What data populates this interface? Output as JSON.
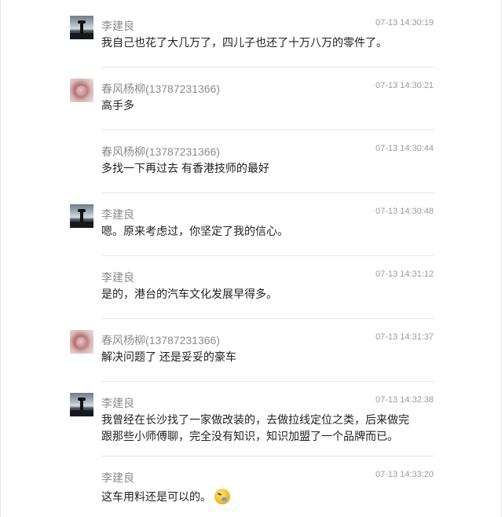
{
  "messages": [
    {
      "author": "李建良",
      "time": "07-13 14:30:19",
      "avatar": "lake-avatar",
      "text": "我自己也花了大几万了，四儿子也还了十万八万的零件了。"
    },
    {
      "author": "春风杨柳(13787231366)",
      "time": "07-13 14:30:21",
      "avatar": "flower-avatar",
      "text": "高手多"
    },
    {
      "author": "春风杨柳(13787231366)",
      "time": "07-13 14:30:44",
      "avatar": "",
      "text": "多找一下再过去 有香港技师的最好"
    },
    {
      "author": "李建良",
      "time": "07-13 14:30:48",
      "avatar": "lake-avatar",
      "text": "嗯。原来考虑过，你坚定了我的信心。"
    },
    {
      "author": "李建良",
      "time": "07-13 14:31:12",
      "avatar": "",
      "text": "是的，港台的汽车文化发展早得多。"
    },
    {
      "author": "春风杨柳(13787231366)",
      "time": "07-13 14:31:37",
      "avatar": "flower-avatar",
      "text": "解决问题了 还是妥妥的豪车"
    },
    {
      "author": "李建良",
      "time": "07-13 14:32:38",
      "avatar": "lake-avatar",
      "text_lines": [
        "我曾经在长沙找了一家做改装的，去做拉线定位之类，后来做完",
        "跟那些小师傅聊，完全没有知识，知识加盟了一个品牌而已。"
      ]
    },
    {
      "author": "李建良",
      "time": "07-13 14:33:20",
      "avatar": "",
      "text": "这车用料还是可以的。",
      "emoji": "crying-laughing-emoji-icon"
    }
  ]
}
